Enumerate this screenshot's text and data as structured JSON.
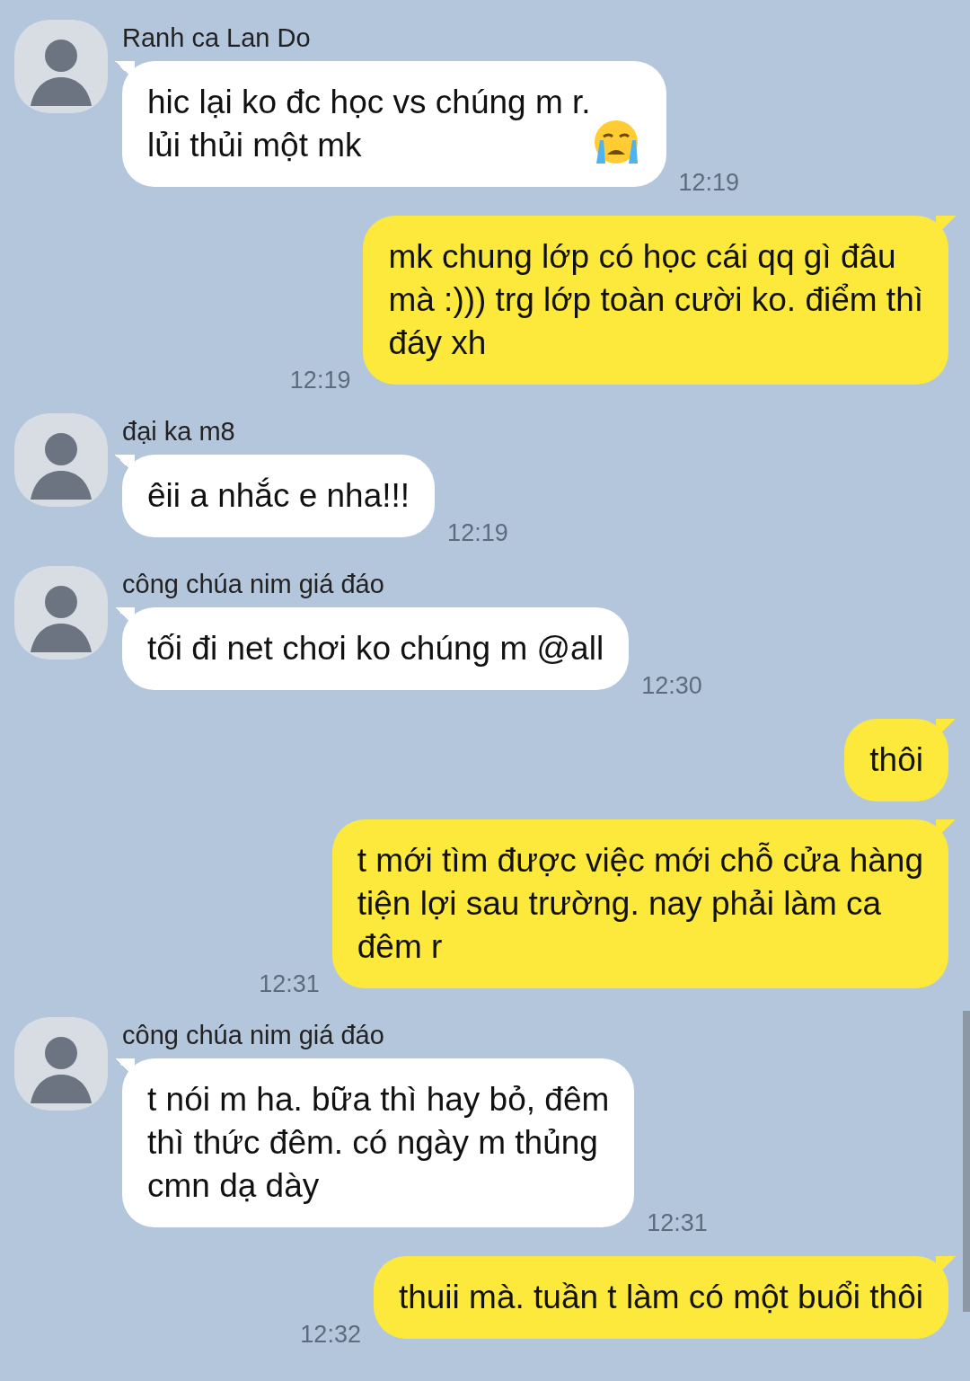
{
  "messages": [
    {
      "kind": "in",
      "sender": "Ranh ca Lan Do",
      "text": "hic lại ko đc học vs chúng m r.\nlủi thủi một mk",
      "emoji": true,
      "time": "12:19"
    },
    {
      "kind": "out",
      "text": "mk chung lớp có học cái qq gì đâu\nmà :))) trg lớp toàn cười ko. điểm thì\nđáy xh",
      "emoji": false,
      "time": "12:19"
    },
    {
      "kind": "in",
      "sender": "đại ka m8",
      "text": "êii a nhắc e nha!!!",
      "emoji": false,
      "time": "12:19"
    },
    {
      "kind": "in",
      "sender": "công chúa nim giá đáo",
      "text": "tối đi net chơi ko chúng m @all",
      "emoji": false,
      "time": "12:30"
    },
    {
      "kind": "out",
      "text": "thôi",
      "emoji": false
    },
    {
      "kind": "out",
      "text": "t mới tìm được việc mới chỗ cửa hàng\ntiện lợi sau trường. nay phải làm ca\nđêm r",
      "emoji": false,
      "time": "12:31"
    },
    {
      "kind": "in",
      "sender": "công chúa nim giá đáo",
      "text": "t nói m ha. bữa thì hay bỏ, đêm\nthì thức đêm. có ngày m thủng\ncmn dạ dày",
      "emoji": false,
      "time": "12:31"
    },
    {
      "kind": "out",
      "text": "thuii mà. tuần t làm có một buổi thôi",
      "emoji": false,
      "time": "12:32"
    }
  ]
}
